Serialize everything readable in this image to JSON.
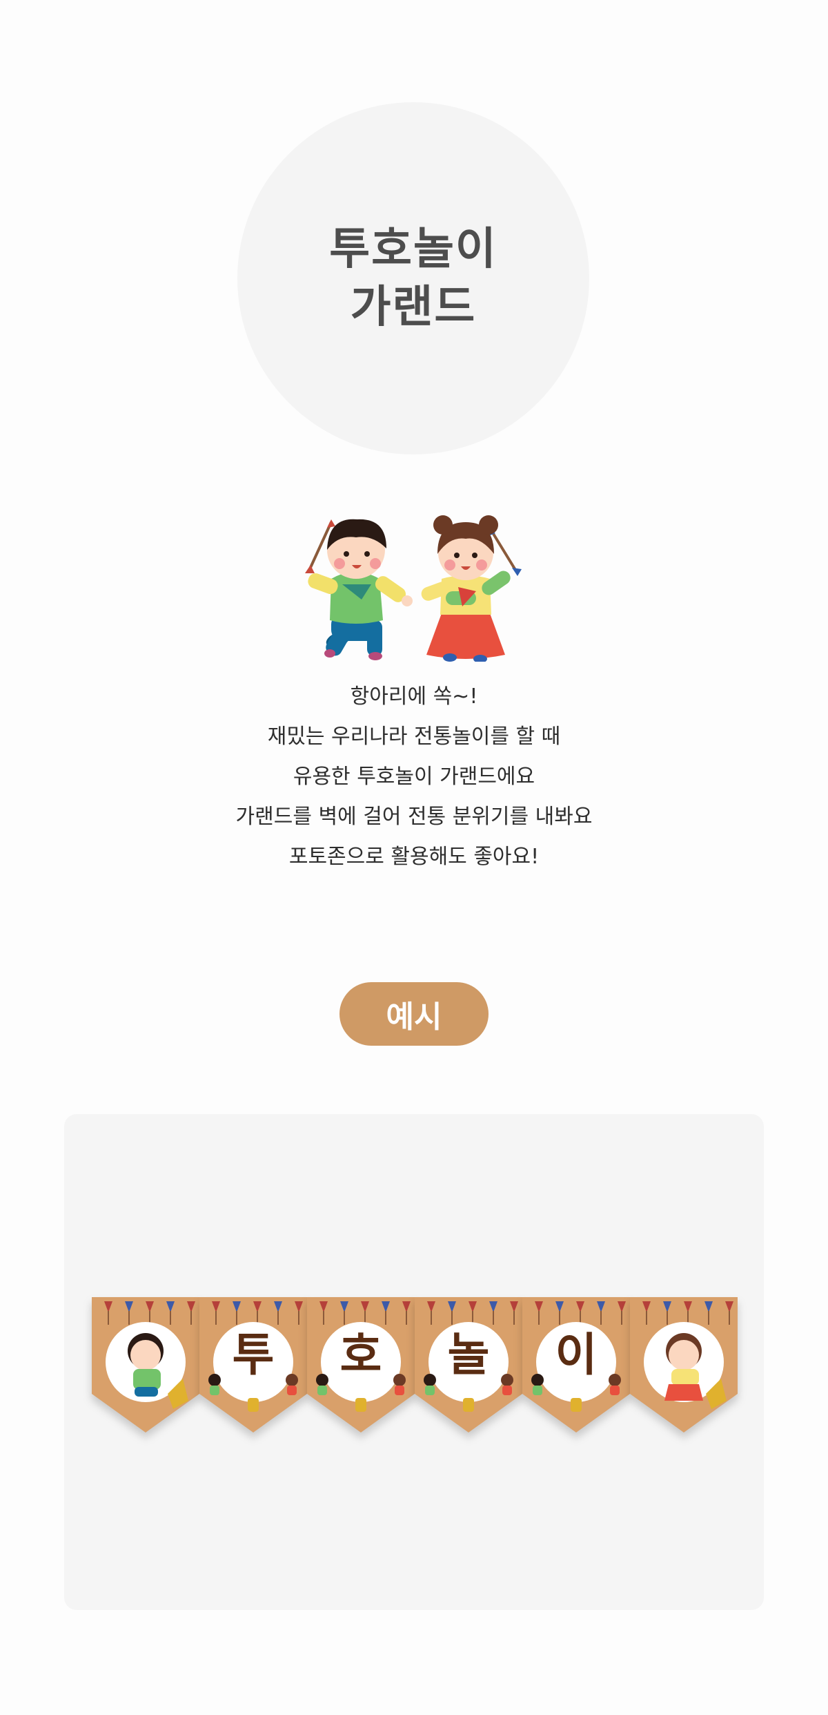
{
  "title": {
    "line1": "투호놀이",
    "line2": "가랜드"
  },
  "description": {
    "lines": [
      "항아리에 쏙~!",
      "재밌는 우리나라 전통놀이를 할 때",
      "유용한 투호놀이 가랜드에요",
      "가랜드를 벽에 걸어 전통 분위기를 내봐요",
      "포토존으로 활용해도 좋아요!"
    ]
  },
  "example": {
    "label": "예시",
    "garland": {
      "flags": [
        {
          "kind": "boy-illustration",
          "letter": ""
        },
        {
          "kind": "letter",
          "letter": "투"
        },
        {
          "kind": "letter",
          "letter": "호"
        },
        {
          "kind": "letter",
          "letter": "놀"
        },
        {
          "kind": "letter",
          "letter": "이"
        },
        {
          "kind": "girl-illustration",
          "letter": ""
        }
      ]
    }
  },
  "colors": {
    "badge": "#cf9a65",
    "flag": "#d9a06a",
    "letter": "#5a2c12"
  }
}
